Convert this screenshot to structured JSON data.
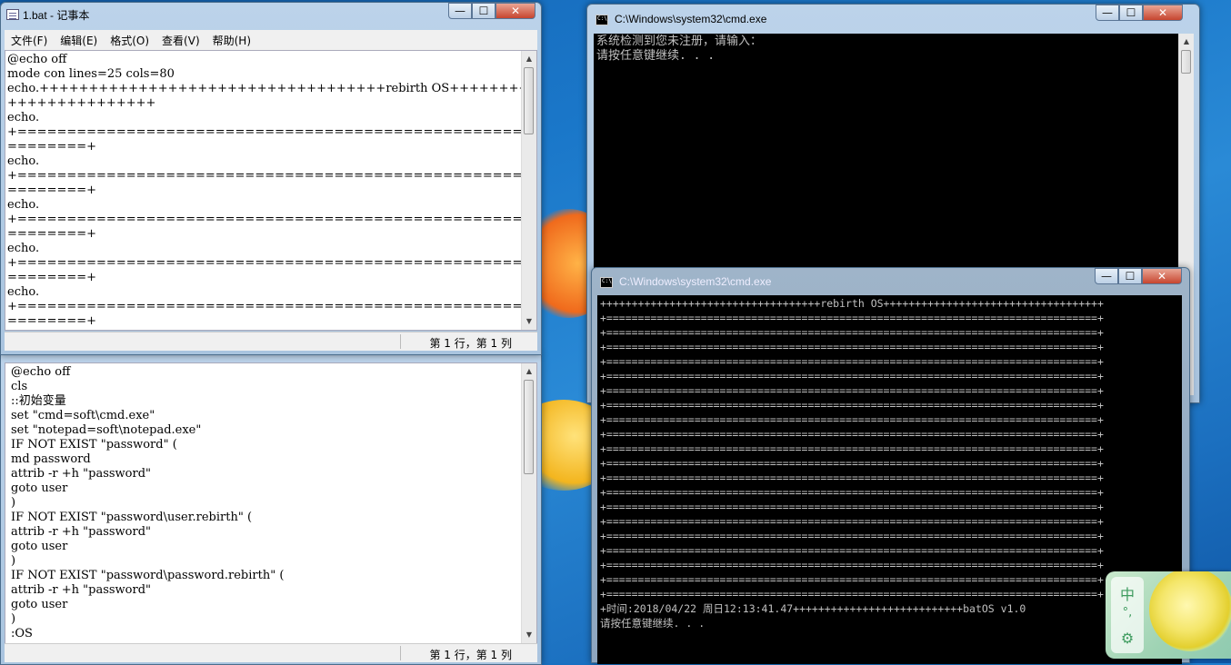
{
  "notepad": {
    "title": "1.bat - 记事本",
    "menu": [
      "文件(F)",
      "编辑(E)",
      "格式(O)",
      "查看(V)",
      "帮助(H)"
    ],
    "content": "@echo off\nmode con lines=25 cols=80\necho.+++++++++++++++++++++++++++++++++++rebirth OS+++++++++++++++++++++\n+++++++++++++++\necho.\n+==================================================================\n========+\necho.\n+==================================================================\n========+\necho.\n+==================================================================\n========+\necho.\n+==================================================================\n========+\necho.\n+==================================================================\n========+",
    "status": "第 1 行，第 1 列"
  },
  "notepad2": {
    "content": "@echo off\ncls\n::初始变量\nset \"cmd=soft\\cmd.exe\"\nset \"notepad=soft\\notepad.exe\"\nIF NOT EXIST \"password\" (\nmd password\nattrib -r +h \"password\"\ngoto user\n)\nIF NOT EXIST \"password\\user.rebirth\" (\nattrib -r +h \"password\"\ngoto user\n)\nIF NOT EXIST \"password\\password.rebirth\" (\nattrib -r +h \"password\"\ngoto user\n)\n:OS",
    "status": "第 1 行，第 1 列"
  },
  "cmd1": {
    "title": "C:\\Windows\\system32\\cmd.exe",
    "content": "系统检测到您未注册，请输入：\n请按任意键继续. . ."
  },
  "cmd2": {
    "title": "C:\\Windows\\system32\\cmd.exe",
    "content": "+++++++++++++++++++++++++++++++++++rebirth OS+++++++++++++++++++++++++++++++++++\n+==============================================================================+\n+==============================================================================+\n+==============================================================================+\n+==============================================================================+\n+==============================================================================+\n+==============================================================================+\n+==============================================================================+\n+==============================================================================+\n+==============================================================================+\n+==============================================================================+\n+==============================================================================+\n+==============================================================================+\n+==============================================================================+\n+==============================================================================+\n+==============================================================================+\n+==============================================================================+\n+==============================================================================+\n+==============================================================================+\n+==============================================================================+\n+==============================================================================+\n+时间:2018/04/22 周日12:13:41.47+++++++++++++++++++++++++++batOS v1.0\n请按任意键继续. . ."
  },
  "ime": {
    "mode": "中",
    "punct": "°,",
    "settings_glyph": "⚙"
  },
  "window_controls": {
    "minimize": "—",
    "maximize": "☐",
    "close": "✕"
  }
}
